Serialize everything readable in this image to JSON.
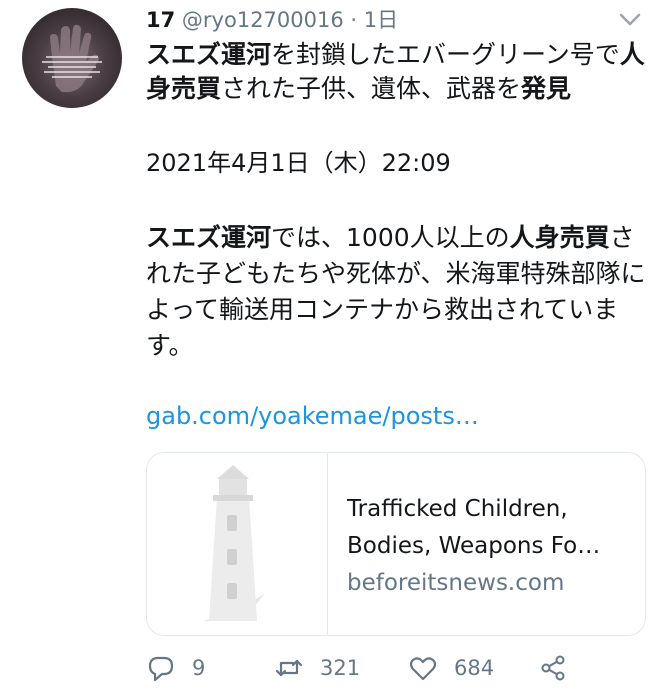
{
  "tweet": {
    "author_name": "17",
    "handle": "@ryo12700016",
    "separator": "·",
    "age": "1日",
    "title": {
      "p1": "スエズ運河",
      "p2": "を封鎖したエバーグリーン号で",
      "p3": "人身売買",
      "p4": "された子供、遺体、武器を",
      "p5": "発見"
    },
    "date_line": "2021年4月1日（木）22:09",
    "body": {
      "p1": "スエズ運河",
      "p2": "では、1000人以上の",
      "p3": "人身売買",
      "p4": "された子どもたちや死体が、米海軍特殊部隊によって輸送用コンテナから救出されています。"
    },
    "link": "gab.com/yoakemae/posts…",
    "card": {
      "title_line1": "Trafficked Children,",
      "title_line2": "Bodies, Weapons Fo…",
      "domain": "beforeitsnews.com"
    },
    "actions": {
      "replies": "9",
      "retweets": "321",
      "likes": "684"
    }
  },
  "icons": {
    "reply": "reply-icon",
    "retweet": "retweet-icon",
    "like": "heart-icon",
    "share": "share-icon",
    "menu": "chevron-down-icon",
    "thumbnail": "lighthouse-icon"
  },
  "colors": {
    "link": "#1b95e0",
    "secondary": "#657786",
    "border": "#e1e8ed",
    "text": "#14171a"
  }
}
